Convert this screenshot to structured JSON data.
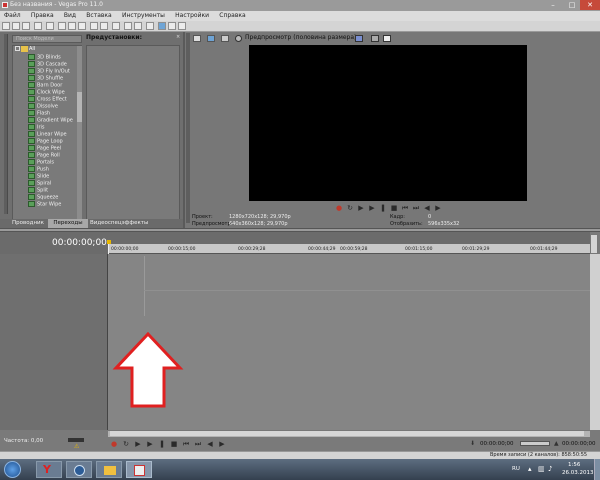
{
  "window": {
    "title": "Без названия - Vegas Pro 11.0",
    "controls": [
      "–",
      "□",
      "✕"
    ]
  },
  "menu": [
    "Файл",
    "Правка",
    "Вид",
    "Вставка",
    "Инструменты",
    "Настройки",
    "Справка"
  ],
  "left_panel": {
    "search_placeholder": "Поиск Модели",
    "root_label": "All",
    "transitions": [
      "3D Blinds",
      "3D Cascade",
      "3D Fly In/Out",
      "3D Shuffle",
      "Barn Door",
      "Clock Wipe",
      "Cross Effect",
      "Dissolve",
      "Flash",
      "Gradient Wipe",
      "Iris",
      "Linear Wipe",
      "Page Loop",
      "Page Peel",
      "Page Roll",
      "Portals",
      "Push",
      "Slide",
      "Spiral",
      "Split",
      "Squeeze",
      "Star Wipe"
    ],
    "presets_header": "Предустановки:",
    "tabs": [
      "Проводник",
      "Переходы",
      "Видеоспецэффекты"
    ]
  },
  "preview": {
    "mode_label": "Предпросмотр (половина размера)",
    "project_label": "Проект:",
    "project_value": "1280x720x128; 29,970p",
    "preview_label": "Предпросмотр:",
    "preview_value": "640x360x128; 29,970p",
    "frame_label": "Кадр:",
    "frame_value": "0",
    "display_label": "Отобразить:",
    "display_value": "596x335x32"
  },
  "timeline": {
    "timecode": "00:00:00;00",
    "ruler": [
      "00:00:00;00",
      "00:00:15;00",
      "00:00:29;28",
      "00:00:44;29",
      "00:00:59;28",
      "00:01:15;00",
      "00:01:29;29",
      "00:01:44;29"
    ],
    "rate_label": "Частота: 0,00",
    "end_time": "00:00:00;00",
    "end_time2": "00:00:00;00",
    "record_time": "Время записи (2 каналов): 858:50:55"
  },
  "taskbar": {
    "lang": "RU",
    "time": "1:56",
    "date": "26.03.2013"
  },
  "colors": {
    "accent": "#c0392b",
    "arrow_outline": "#e02020"
  }
}
